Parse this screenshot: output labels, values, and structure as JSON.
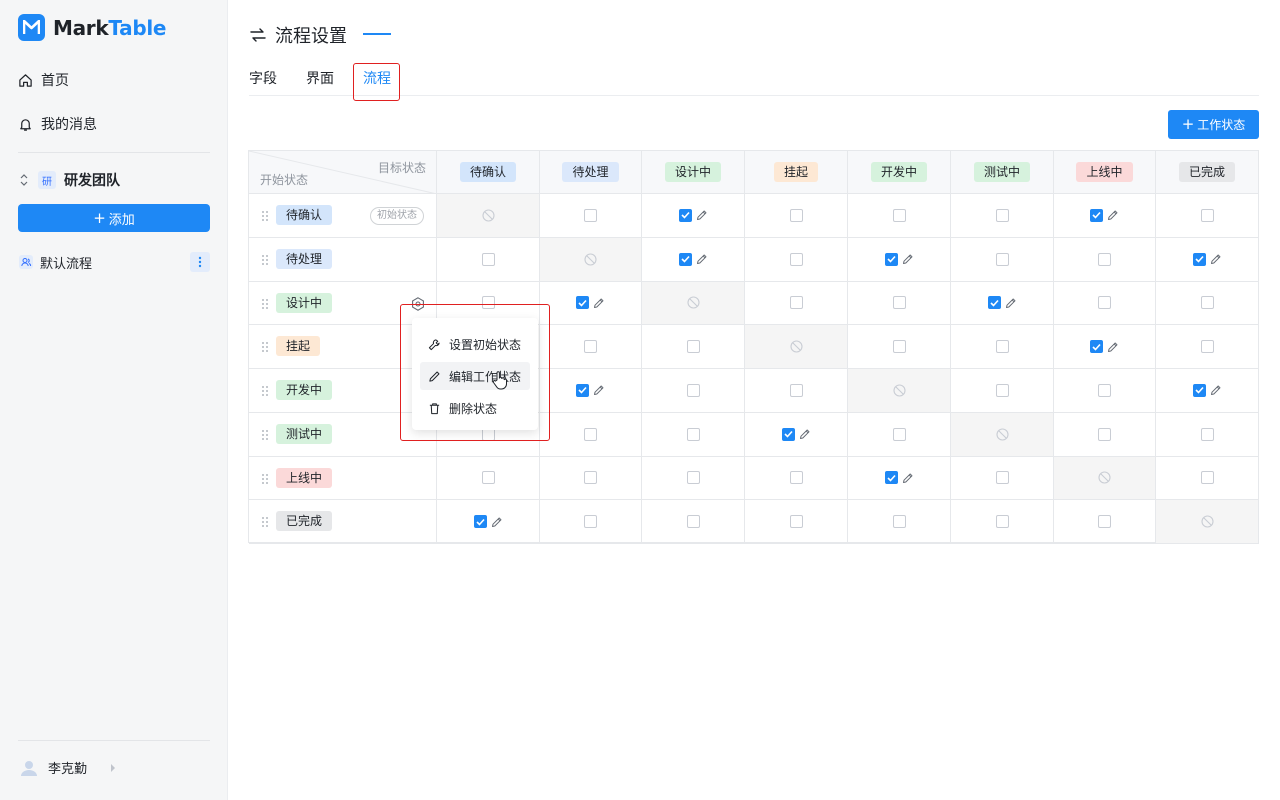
{
  "app": {
    "logo_prefix": "Mark",
    "logo_suffix": "Table",
    "accent": "#1e88f5"
  },
  "sidebar": {
    "nav": [
      {
        "label": "首页",
        "icon": "home-icon"
      },
      {
        "label": "我的消息",
        "icon": "bell-icon"
      }
    ],
    "team": {
      "badge": "研",
      "name": "研发团队"
    },
    "add_label": "添加",
    "flows": [
      {
        "label": "默认流程"
      }
    ],
    "user": {
      "name": "李克勤"
    }
  },
  "header": {
    "title": "流程设置",
    "tabs": [
      {
        "label": "字段"
      },
      {
        "label": "界面"
      },
      {
        "label": "流程"
      }
    ],
    "active_tab": "流程"
  },
  "toolbar": {
    "add_state_label": "工作状态"
  },
  "matrix": {
    "corner_target": "目标状态",
    "corner_source": "开始状态",
    "initial_badge": "初始状态",
    "states": [
      {
        "label": "待确认",
        "bg": "#d3e5fb",
        "fg": "#1f2329"
      },
      {
        "label": "待处理",
        "bg": "#dbe8fb",
        "fg": "#1f2329"
      },
      {
        "label": "设计中",
        "bg": "#d6f2dd",
        "fg": "#1f2329"
      },
      {
        "label": "挂起",
        "bg": "#fde8d4",
        "fg": "#1f2329"
      },
      {
        "label": "开发中",
        "bg": "#d6f2dd",
        "fg": "#1f2329"
      },
      {
        "label": "测试中",
        "bg": "#d6f2dd",
        "fg": "#1f2329"
      },
      {
        "label": "上线中",
        "bg": "#fbd9d9",
        "fg": "#1f2329"
      },
      {
        "label": "已完成",
        "bg": "#e6e7e9",
        "fg": "#1f2329"
      }
    ],
    "transitions": [
      [
        2,
        6
      ],
      [
        2,
        4,
        7
      ],
      [
        1,
        5
      ],
      [
        6
      ],
      [
        1,
        7
      ],
      [
        3
      ],
      [
        4
      ],
      [
        0
      ]
    ]
  },
  "context_menu": {
    "items": [
      {
        "label": "设置初始状态",
        "icon": "wrench-icon"
      },
      {
        "label": "编辑工作状态",
        "icon": "pencil-icon"
      },
      {
        "label": "删除状态",
        "icon": "trash-icon"
      }
    ],
    "hovered_index": 1
  }
}
